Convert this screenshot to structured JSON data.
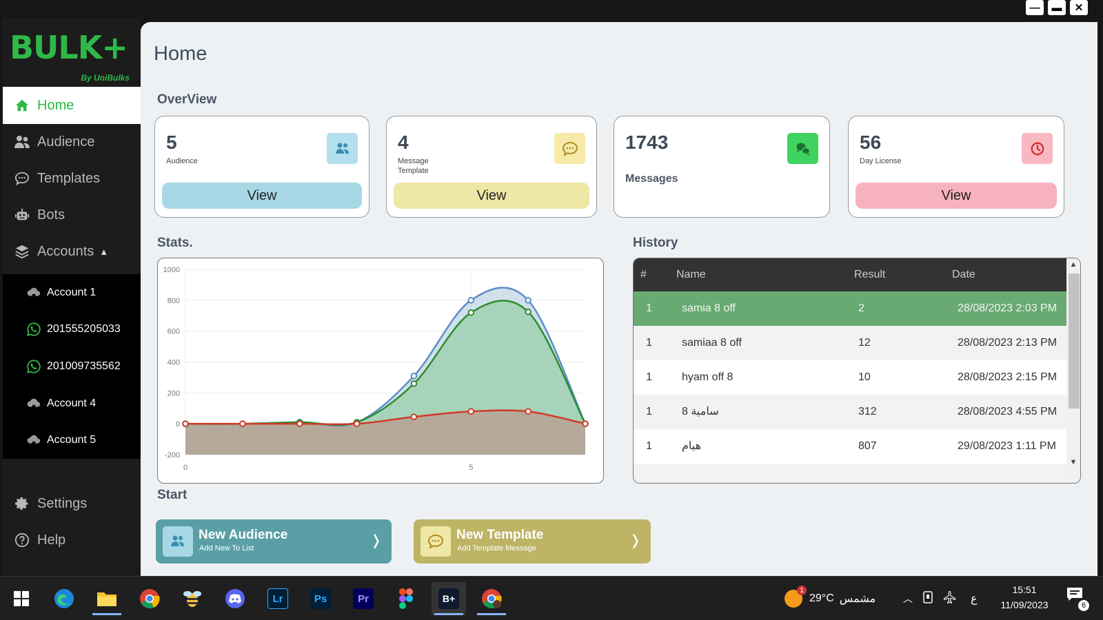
{
  "window": {
    "minimize": "—",
    "maximize": "▬",
    "close": "✕"
  },
  "sidebar": {
    "logo": {
      "main": "BULK+",
      "sub": "By UniBulks"
    },
    "items": [
      {
        "label": "Home",
        "icon": "home-icon"
      },
      {
        "label": "Audience",
        "icon": "users-icon"
      },
      {
        "label": "Templates",
        "icon": "chat-icon"
      },
      {
        "label": "Bots",
        "icon": "robot-icon"
      },
      {
        "label": "Accounts",
        "icon": "layers-icon",
        "caret": "▲"
      }
    ],
    "accounts": [
      {
        "label": "Account 1",
        "icon": "account-icon"
      },
      {
        "label": "201555205033",
        "icon": "whatsapp-icon"
      },
      {
        "label": "201009735562",
        "icon": "whatsapp-icon"
      },
      {
        "label": "Account 4",
        "icon": "account-icon"
      },
      {
        "label": "Account 5",
        "icon": "account-icon"
      }
    ],
    "bottom": [
      {
        "label": "Settings",
        "icon": "gear-icon"
      },
      {
        "label": "Help",
        "icon": "help-icon"
      }
    ]
  },
  "main": {
    "title": "Home",
    "overview": {
      "title": "OverView",
      "cards": [
        {
          "value": "5",
          "label": "Audience",
          "button": "View",
          "color": "#a8d8e6",
          "badge_color": "#b3dfee"
        },
        {
          "value": "4",
          "label": "Message Template",
          "button": "View",
          "color": "#efe7a6",
          "badge_color": "#f5eaa8"
        },
        {
          "value": "1743",
          "label": "Messages",
          "badge_color": "#3fd35f"
        },
        {
          "value": "56",
          "label": "Day License",
          "button": "View",
          "color": "#f7b3bd",
          "badge_color": "#f8b8c2"
        }
      ]
    },
    "stats": {
      "title": "Stats."
    },
    "history": {
      "title": "History",
      "columns": [
        "#",
        "Name",
        "Result",
        "Date"
      ],
      "rows": [
        {
          "n": "1",
          "name": "samia 8 off",
          "result": "2",
          "date": "28/08/2023 2:03 PM"
        },
        {
          "n": "1",
          "name": "samiaa 8 off",
          "result": "12",
          "date": "28/08/2023 2:13 PM"
        },
        {
          "n": "1",
          "name": "hyam off 8",
          "result": "10",
          "date": "28/08/2023 2:15 PM"
        },
        {
          "n": "1",
          "name": "سامية 8",
          "result": "312",
          "date": "28/08/2023 4:55 PM"
        },
        {
          "n": "1",
          "name": "هيام",
          "result": "807",
          "date": "29/08/2023 1:11 PM"
        }
      ],
      "scroll_up": "▲",
      "scroll_down": "▼"
    },
    "start": {
      "title": "Start",
      "buttons": [
        {
          "title": "New Audience",
          "subtitle": "Add New To List",
          "chevron": "❭",
          "color": "#5a9fa6"
        },
        {
          "title": "New Template",
          "subtitle": "Add Template Message",
          "chevron": "❭",
          "color": "#bdb466"
        }
      ]
    }
  },
  "chart_data": {
    "type": "area",
    "x": [
      0,
      1,
      2,
      3,
      4,
      5,
      6,
      7
    ],
    "xticks": [
      "0",
      "5"
    ],
    "ylim": [
      -200,
      1000
    ],
    "yticks": [
      1000,
      800,
      600,
      400,
      200,
      0,
      -200
    ],
    "grid": true,
    "legend": "none",
    "series": [
      {
        "values": [
          0,
          0,
          10,
          10,
          310,
          800,
          800,
          0
        ],
        "color": "#5b8fc7",
        "fill": "#c9dbe8"
      },
      {
        "values": [
          0,
          0,
          10,
          10,
          260,
          720,
          725,
          0
        ],
        "color": "#2e8b2e",
        "fill": "#9fd0b0"
      },
      {
        "values": [
          0,
          0,
          0,
          0,
          45,
          80,
          80,
          0
        ],
        "color": "#d03a2a",
        "fill": "#b5a99a"
      }
    ]
  },
  "taskbar": {
    "apps": [
      "windows-start-icon",
      "edge-icon",
      "file-explorer-icon",
      "chrome-icon",
      "bee-app-icon",
      "discord-icon",
      "lightroom-icon",
      "photoshop-icon",
      "premiere-icon",
      "figma-icon",
      "bulkplus-icon",
      "chrome-profile-icon"
    ],
    "lr": "Lr",
    "ps": "Ps",
    "pr": "Pr",
    "bplus": "B+",
    "weather_badge": "1",
    "weather_temp": "29°C",
    "weather_text": "مشمس",
    "lang": "ع",
    "time": "15:51",
    "date": "11/09/2023",
    "notif_count": "6"
  }
}
